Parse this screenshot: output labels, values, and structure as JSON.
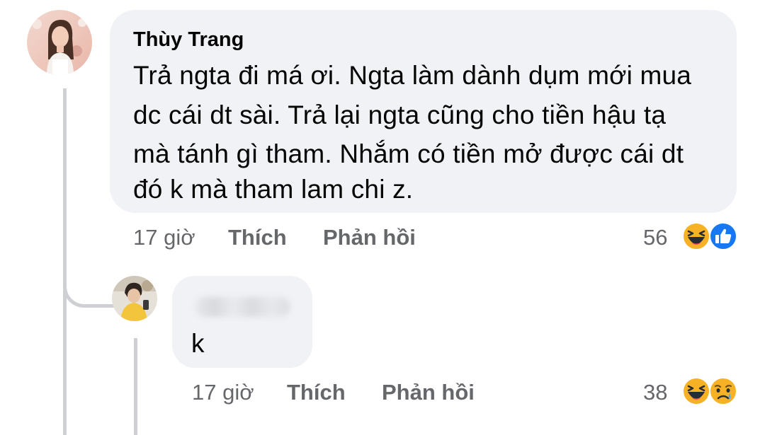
{
  "comment": {
    "author": "Thùy Trang",
    "lines": [
      "Trả ngta đi má ơi. Ngta làm dành dụm mới mua",
      "dc cái dt sài. Trả lại ngta cũng cho tiền hậu tạ",
      "mà tánh gì tham. Nhắm có tiền mở được cái dt",
      "đó k mà tham lam chi z."
    ],
    "time": "17 giờ",
    "like_label": "Thích",
    "reply_label": "Phản hồi",
    "reaction_count": "56",
    "reactions": [
      "haha-icon",
      "like-icon"
    ]
  },
  "reply": {
    "author": "",
    "lines": [
      "k"
    ],
    "time": "17 giờ",
    "like_label": "Thích",
    "reply_label": "Phản hồi",
    "reaction_count": "38",
    "reactions": [
      "haha-icon",
      "sad-icon"
    ]
  },
  "colors": {
    "bubble": "#f0f2f5",
    "text": "#050505",
    "meta": "#65676b",
    "like_blue": "#1877f2",
    "emoji_yellow": "#f7b125"
  }
}
